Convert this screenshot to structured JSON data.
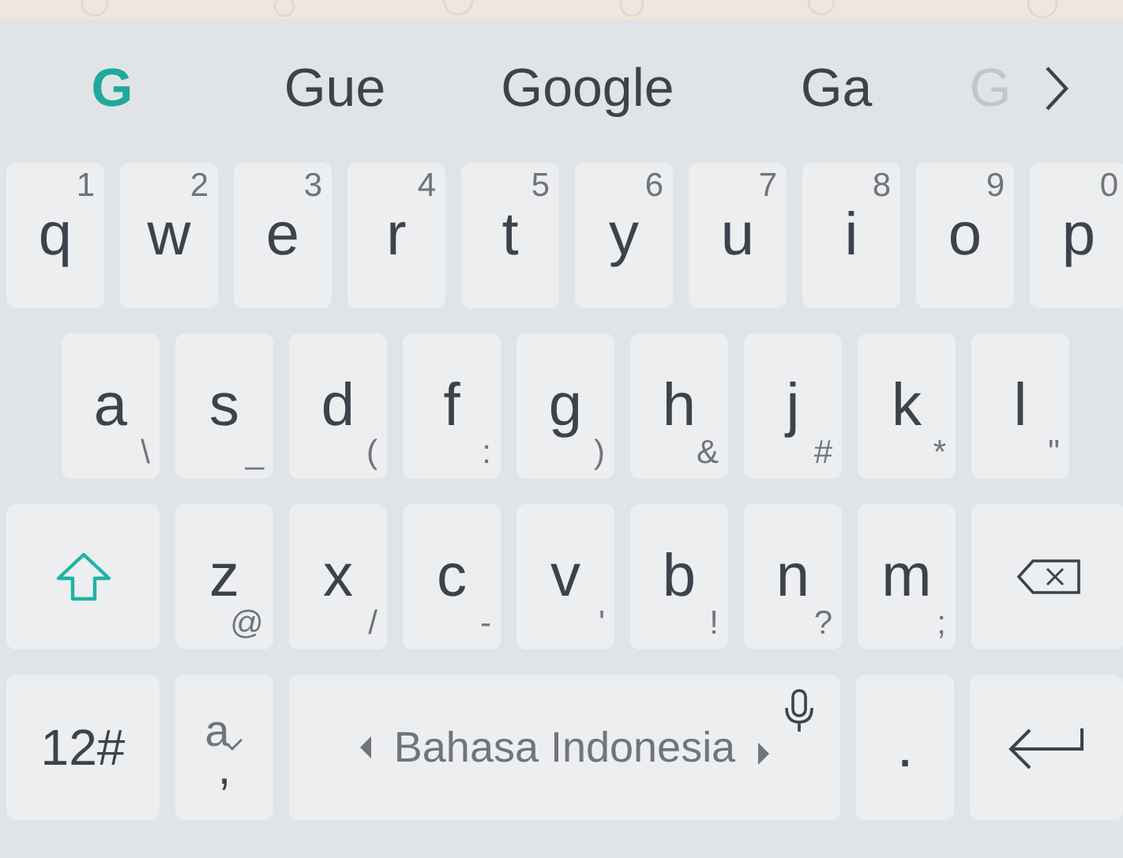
{
  "suggestions": [
    {
      "text": "G",
      "selected": true,
      "kind": "word"
    },
    {
      "text": "Gue",
      "selected": false,
      "kind": "word"
    },
    {
      "text": "Google",
      "selected": false,
      "kind": "word"
    },
    {
      "text": "Ga",
      "selected": false,
      "kind": "word"
    },
    {
      "text": "G",
      "selected": false,
      "kind": "faded"
    }
  ],
  "rows": [
    {
      "keys": [
        {
          "kind": "letter",
          "label": "q",
          "number": "1"
        },
        {
          "kind": "letter",
          "label": "w",
          "number": "2"
        },
        {
          "kind": "letter",
          "label": "e",
          "number": "3"
        },
        {
          "kind": "letter",
          "label": "r",
          "number": "4"
        },
        {
          "kind": "letter",
          "label": "t",
          "number": "5"
        },
        {
          "kind": "letter",
          "label": "y",
          "number": "6"
        },
        {
          "kind": "letter",
          "label": "u",
          "number": "7"
        },
        {
          "kind": "letter",
          "label": "i",
          "number": "8"
        },
        {
          "kind": "letter",
          "label": "o",
          "number": "9"
        },
        {
          "kind": "letter",
          "label": "p",
          "number": "0"
        }
      ]
    },
    {
      "keys": [
        {
          "kind": "letter",
          "label": "a",
          "symbol": "\\"
        },
        {
          "kind": "letter",
          "label": "s",
          "symbol": "_"
        },
        {
          "kind": "letter",
          "label": "d",
          "symbol": "("
        },
        {
          "kind": "letter",
          "label": "f",
          "symbol": ":"
        },
        {
          "kind": "letter",
          "label": "g",
          "symbol": ")"
        },
        {
          "kind": "letter",
          "label": "h",
          "symbol": "&"
        },
        {
          "kind": "letter",
          "label": "j",
          "symbol": "#"
        },
        {
          "kind": "letter",
          "label": "k",
          "symbol": "*"
        },
        {
          "kind": "letter",
          "label": "l",
          "symbol": "\""
        }
      ]
    },
    {
      "keys": [
        {
          "kind": "shift"
        },
        {
          "kind": "letter",
          "label": "z",
          "symbol": "@"
        },
        {
          "kind": "letter",
          "label": "x",
          "symbol": "/"
        },
        {
          "kind": "letter",
          "label": "c",
          "symbol": "-"
        },
        {
          "kind": "letter",
          "label": "v",
          "symbol": "'"
        },
        {
          "kind": "letter",
          "label": "b",
          "symbol": "!"
        },
        {
          "kind": "letter",
          "label": "n",
          "symbol": "?"
        },
        {
          "kind": "letter",
          "label": "m",
          "symbol": ";"
        },
        {
          "kind": "backspace"
        }
      ]
    },
    {
      "keys": [
        {
          "kind": "symbols",
          "label": "12#"
        },
        {
          "kind": "language",
          "label": "a",
          "symbol": ","
        },
        {
          "kind": "space",
          "label": "Bahasa Indonesia"
        },
        {
          "kind": "letter",
          "label": "."
        },
        {
          "kind": "enter"
        }
      ]
    }
  ]
}
